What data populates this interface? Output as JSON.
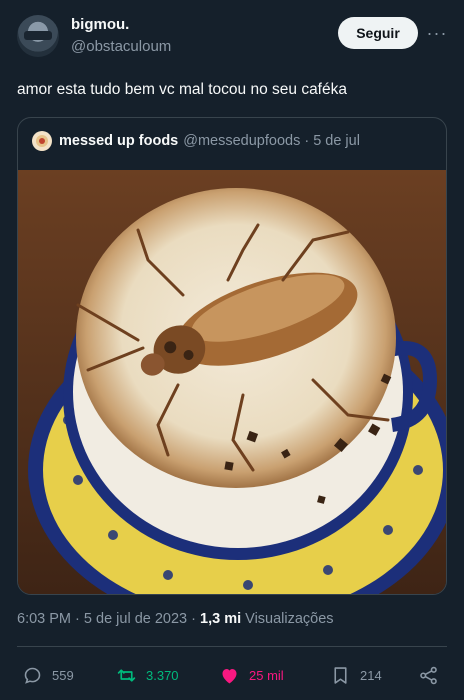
{
  "author": {
    "name": "bigmou.",
    "handle": "@obstaculoum"
  },
  "follow_label": "Seguir",
  "more_label": "···",
  "tweet_text": "amor esta tudo bem vc mal tocou no seu caféka",
  "quoted": {
    "name": "messed up foods",
    "handle": "@messedupfoods",
    "separator": "·",
    "date": "5 de jul"
  },
  "meta": {
    "time": "6:03 PM",
    "separator": "·",
    "date": "5 de jul de 2023",
    "views_count": "1,3 mi",
    "views_label": "Visualizações"
  },
  "stats": {
    "replies": "559",
    "retweets": "3.370",
    "likes": "25 mil",
    "bookmarks": "214"
  },
  "colors": {
    "background": "#15202b",
    "retweet_active": "#00ba7c",
    "like_active": "#f91880",
    "muted": "#8b98a5"
  }
}
